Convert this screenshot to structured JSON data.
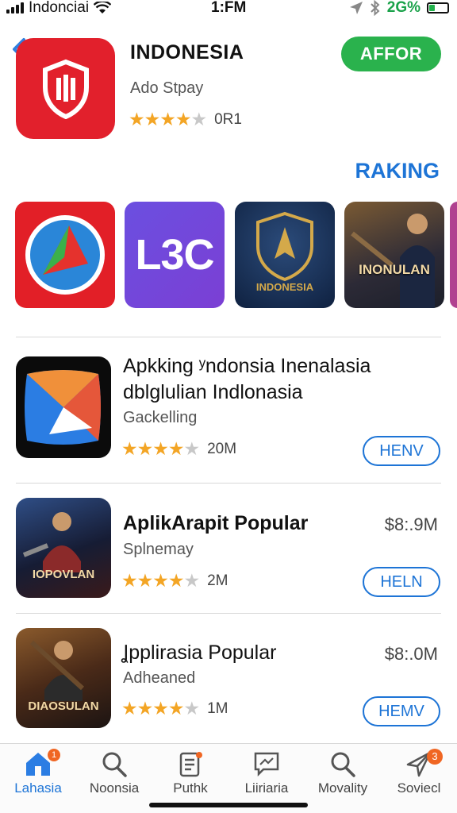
{
  "status_bar": {
    "carrier": "Indonciai",
    "time": "1:FM",
    "battery_pct": "2G%",
    "battery_level": 0.3
  },
  "header_app": {
    "title": "INDONESIA",
    "subtitle": "Ado Stpay",
    "rating_count": "0R1",
    "get_label": "AFFOR"
  },
  "ranking": {
    "title": "RAKING",
    "tiles": [
      {
        "label": ""
      },
      {
        "label": "L3C"
      },
      {
        "label": "INDONESIA"
      },
      {
        "label": "INONULAN"
      }
    ]
  },
  "list": [
    {
      "title_line1": "Apkking ʸndonsia Inenalasia",
      "title_line2": "dblglulian Indlonasia",
      "subtitle": "Gackelling",
      "rating_count": "20M",
      "price": "",
      "button": "HENV"
    },
    {
      "title_line1": "AplikArapit Popular",
      "subtitle": "Splnemay",
      "rating_count": "2M",
      "price": "$8:.9M",
      "button": "HELN",
      "icon_text": "IOPOVLAN"
    },
    {
      "title_line1": "Ʝpplirasia Popular",
      "subtitle": "Adheaned",
      "rating_count": "1M",
      "price": "$8:.0M",
      "button": "HEMV",
      "icon_text": "DIAOSULAN"
    }
  ],
  "tab_bar": {
    "tabs": [
      {
        "label": "Lahasia",
        "icon": "home-icon",
        "badge": "1"
      },
      {
        "label": "Noonsia",
        "icon": "search-icon"
      },
      {
        "label": "Puthk",
        "icon": "list-icon"
      },
      {
        "label": "Liiriaria",
        "icon": "chat-icon"
      },
      {
        "label": "Movality",
        "icon": "search-icon"
      },
      {
        "label": "Soviecl",
        "icon": "send-icon",
        "badge": "3"
      }
    ]
  },
  "colors": {
    "accent": "#1d74d6",
    "get_button": "#2ab24d",
    "star": "#f3a525",
    "badge": "#f06623"
  }
}
